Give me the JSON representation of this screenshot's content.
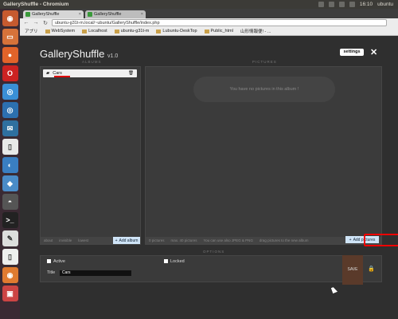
{
  "os": {
    "window_title": "GalleryShuffle - Chromium",
    "time": "16:10",
    "user": "ubuntu"
  },
  "browser": {
    "tabs": [
      {
        "label": "GalleryShuffle",
        "active": true
      },
      {
        "label": "GalleryShuffle",
        "active": false
      }
    ],
    "url": "ubuntu-g31t-m.local/~ubuntu/GalleryShuffle/index.php",
    "bookmarks": [
      "アプリ",
      "WebSystem",
      "Localhost",
      "ubuntu-g31t-m",
      "Lubuntu-DeskTop",
      "Public_html",
      "山形情報便! - ..."
    ]
  },
  "app": {
    "name": "GalleryShuffle",
    "version": "v1.0",
    "settings_label": "settings",
    "close_label": "✕"
  },
  "albums": {
    "section_label": "ALBUMS",
    "items": [
      {
        "name": "Cars"
      }
    ],
    "footer": [
      "about",
      "invisible",
      "lowest"
    ],
    "add_label": "Add album"
  },
  "pictures": {
    "section_label": "PICTURES",
    "empty_text": "You have no pictures in this album !",
    "footer": [
      "0 pictures",
      "max. 40 pictures",
      "You can use also JPEG & PNG",
      "drag pictures to the new album"
    ],
    "add_label": "Add pictures"
  },
  "options": {
    "section_label": "OPTIONS",
    "active_label": "Active",
    "locked_label": "Locked",
    "title_label": "Title",
    "title_value": "Cars",
    "save_label": "SAVE"
  }
}
